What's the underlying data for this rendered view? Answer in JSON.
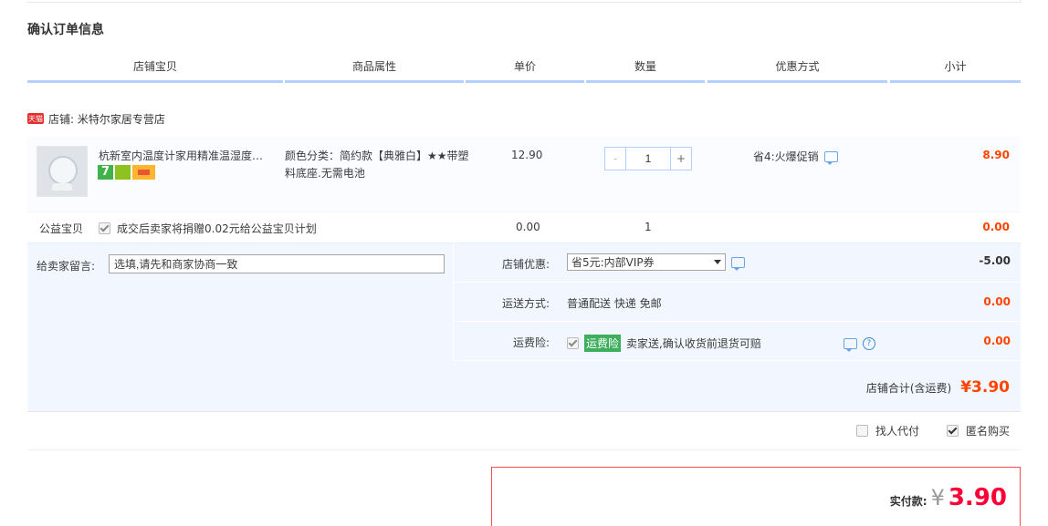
{
  "page": {
    "title": "确认订单信息"
  },
  "table_header": [
    "店铺宝贝",
    "商品属性",
    "单价",
    "数量",
    "优惠方式",
    "小计"
  ],
  "shop": {
    "badge": "天猫",
    "label": "店铺: 米特尔家居专营店"
  },
  "item": {
    "name": "杭新室内温度计家用精准温湿度…",
    "badge_seven": "7",
    "property": "颜色分类：简约款【典雅白】★★带塑料底座.无需电池",
    "unit_price": "12.90",
    "quantity": "1",
    "qty_decrease": "-",
    "qty_increase": "+",
    "promo": "省4:火爆促销",
    "subtotal": "8.90"
  },
  "charity": {
    "label": "公益宝贝",
    "desc": "成交后卖家将捐赠0.02元给公益宝贝计划",
    "price": "0.00",
    "quantity": "1",
    "amount": "0.00"
  },
  "message": {
    "label": "给卖家留言:",
    "placeholder": "选填,请先和商家协商一致"
  },
  "coupon": {
    "label": "店铺优惠:",
    "selected": "省5元:内部VIP券",
    "amount": "-5.00"
  },
  "shipping": {
    "label": "运送方式:",
    "value": "普通配送 快递 免邮",
    "amount": "0.00"
  },
  "insurance": {
    "label": "运费险:",
    "tag": "运费险",
    "desc": "卖家送,确认收货前退货可赔",
    "help": "?",
    "amount": "0.00"
  },
  "shop_total": {
    "label": "店铺合计(含运费)",
    "value": "¥3.90"
  },
  "options": {
    "pay_by_other": "找人代付",
    "anonymous": "匿名购买"
  },
  "payment": {
    "label": "实付款:",
    "currency": "¥",
    "value": "3.90"
  },
  "colors": {
    "price_red": "#ff4400",
    "final_red": "#ff0036",
    "header_blue": "#b2d1ff",
    "panel_bg": "#f2f7ff"
  }
}
